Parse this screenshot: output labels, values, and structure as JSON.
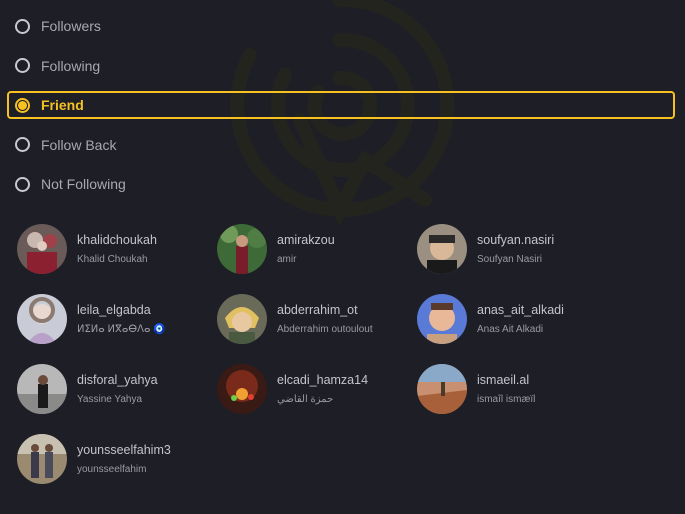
{
  "filters": [
    {
      "label": "Followers",
      "selected": false
    },
    {
      "label": "Following",
      "selected": false
    },
    {
      "label": "Friend",
      "selected": true
    },
    {
      "label": "Follow Back",
      "selected": false
    },
    {
      "label": "Not Following",
      "selected": false
    }
  ],
  "accent_color": "#f6c121",
  "users": [
    {
      "username": "khalidchoukah",
      "name": "Khalid Choukah"
    },
    {
      "username": "amirakzou",
      "name": "amir"
    },
    {
      "username": "soufyan.nasiri",
      "name": "Soufyan Nasiri"
    },
    {
      "username": "leila_elgabda",
      "name": "ⵍⵉⵍⴰ ⵍⴳⴰⴱⴷⴰ 🧿"
    },
    {
      "username": "abderrahim_ot",
      "name": "Abderrahim outoulout"
    },
    {
      "username": "anas_ait_alkadi",
      "name": "Anas Ait Alkadi"
    },
    {
      "username": "disforal_yahya",
      "name": "Yassine Yahya"
    },
    {
      "username": "elcadi_hamza14",
      "name": "حمزة القاضي"
    },
    {
      "username": "ismaeil.al",
      "name": "ismaîl ismæïl"
    },
    {
      "username": "younsseelfahim3",
      "name": "younsseelfahim"
    }
  ]
}
